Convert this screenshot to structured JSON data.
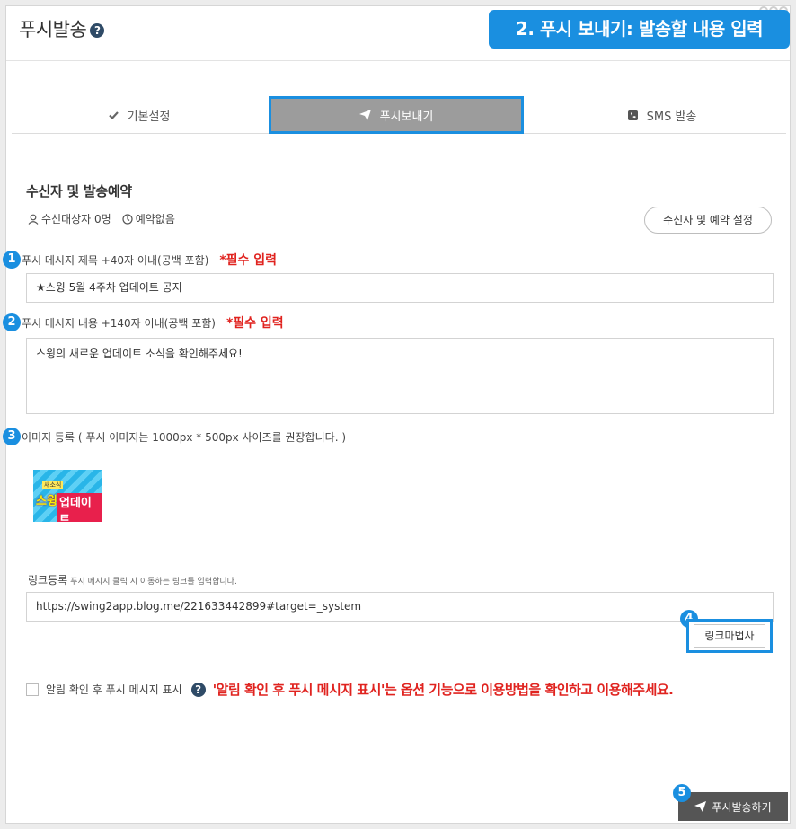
{
  "window": {
    "title": "푸시발송",
    "help_glyph": "?"
  },
  "step_banner": "2. 푸시 보내기: 발송할 내용 입력",
  "tabs": [
    {
      "label": "기본설정",
      "icon": "check-icon"
    },
    {
      "label": "푸시보내기",
      "icon": "paper-plane-icon",
      "active": true
    },
    {
      "label": "SMS 발송",
      "icon": "phone-icon"
    }
  ],
  "recipients": {
    "title": "수신자 및 발송예약",
    "target_count": "수신대상자 0명",
    "reservation": "예약없음",
    "settings_button": "수신자 및 예약 설정"
  },
  "fields": {
    "title_label": "푸시 메시지 제목 +40자 이내(공백 포함)",
    "title_required": "*필수 입력",
    "title_value": "★스윙 5월 4주차 업데이트 공지",
    "body_label": "푸시 메시지 내용 +140자 이내(공백 포함)",
    "body_required": "*필수 입력",
    "body_value": "스윙의 새로운 업데이트 소식을 확인해주세요!",
    "image_label": "이미지 등록 ( 푸시 이미지는 1000px * 500px 사이즈를 권장합니다. )",
    "image_tag": "새소식",
    "image_text1": "스윙",
    "image_text2": "업데이트",
    "link_label": "링크등록",
    "link_hint": "푸시 메시지 클릭 시 이동하는 링크를 입력합니다.",
    "link_value": "https://swing2app.blog.me/221633442899#target=_system",
    "wizard_button": "링크마법사"
  },
  "option": {
    "checkbox_label": "알림 확인 후 푸시 메시지 표시",
    "help_glyph": "?",
    "notice": "'알림 확인 후 푸시 메시지 표시'는 옵션 기능으로 이용방법을 확인하고 이용해주세요."
  },
  "badges": [
    "1",
    "2",
    "3",
    "4",
    "5"
  ],
  "send_button": "푸시발송하기",
  "colors": {
    "accent": "#1a8fe0",
    "required": "#e0231f",
    "active_tab": "#9c9c9c",
    "send_button": "#555555"
  }
}
